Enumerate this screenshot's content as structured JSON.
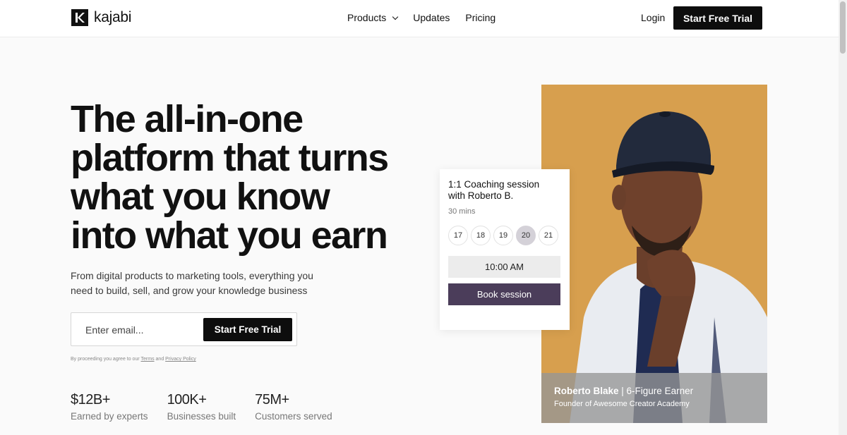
{
  "header": {
    "logo_text": "kajabi",
    "nav": [
      {
        "label": "Products",
        "has_dropdown": true
      },
      {
        "label": "Updates"
      },
      {
        "label": "Pricing"
      }
    ],
    "login_label": "Login",
    "cta_label": "Start Free Trial"
  },
  "hero": {
    "headline_lines": [
      "The all-in-one",
      "platform that turns",
      "what you know",
      "into what you earn"
    ],
    "subtext_lines": [
      "From digital products to marketing tools, everything you",
      "need to build, sell, and grow your knowledge business"
    ],
    "email_placeholder": "Enter email...",
    "form_cta_label": "Start Free Trial",
    "legal": {
      "prefix": "By proceeding you agree to our",
      "terms": "Terms",
      "and": "and",
      "privacy": "Privacy Policy"
    }
  },
  "stats": [
    {
      "value": "$12B+",
      "label": "Earned by experts"
    },
    {
      "value": "100K+",
      "label": "Businesses built"
    },
    {
      "value": "75M+",
      "label": "Customers served"
    }
  ],
  "booking": {
    "title_lines": [
      "1:1 Coaching session",
      "with Roberto B."
    ],
    "duration": "30 mins",
    "dates": [
      "17",
      "18",
      "19",
      "20",
      "21"
    ],
    "selected_date": "20",
    "time": "10:00 AM",
    "book_label": "Book session"
  },
  "testimonial": {
    "name": "Roberto Blake",
    "separator": " | ",
    "title": "6-Figure Earner",
    "role": "Founder of Awesome Creator Academy"
  },
  "colors": {
    "primary_button": "#0d0d0d",
    "book_button": "#4b3d5a",
    "photo_background": "#d79f4e"
  }
}
